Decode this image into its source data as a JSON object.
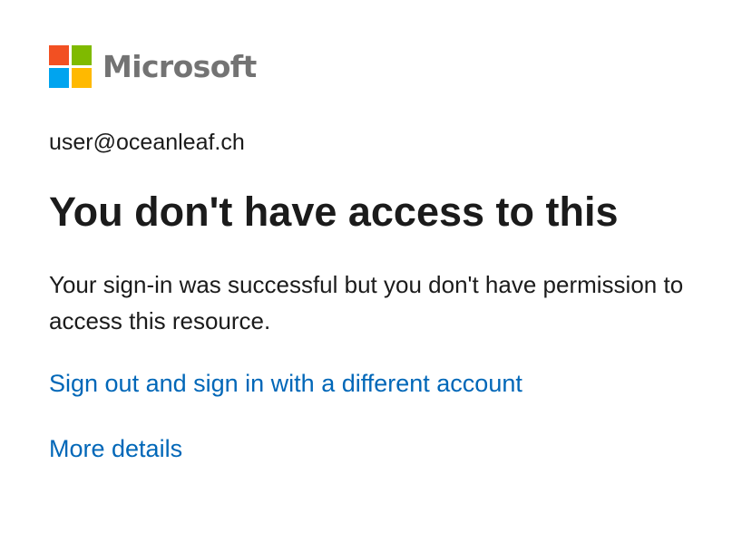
{
  "brand": {
    "name": "Microsoft",
    "logo_icon": "microsoft-logo-icon",
    "colors": {
      "red": "#f25022",
      "green": "#7fba00",
      "blue": "#00a4ef",
      "yellow": "#ffb900",
      "wordmark": "#737373"
    }
  },
  "account": {
    "email": "user@oceanleaf.ch"
  },
  "message": {
    "title": "You don't have access to this",
    "description": "Your sign-in was successful but you don't have permission to access this resource."
  },
  "links": {
    "switch_account": "Sign out and sign in with a different account",
    "more_details": "More details",
    "color": "#0067b8"
  }
}
